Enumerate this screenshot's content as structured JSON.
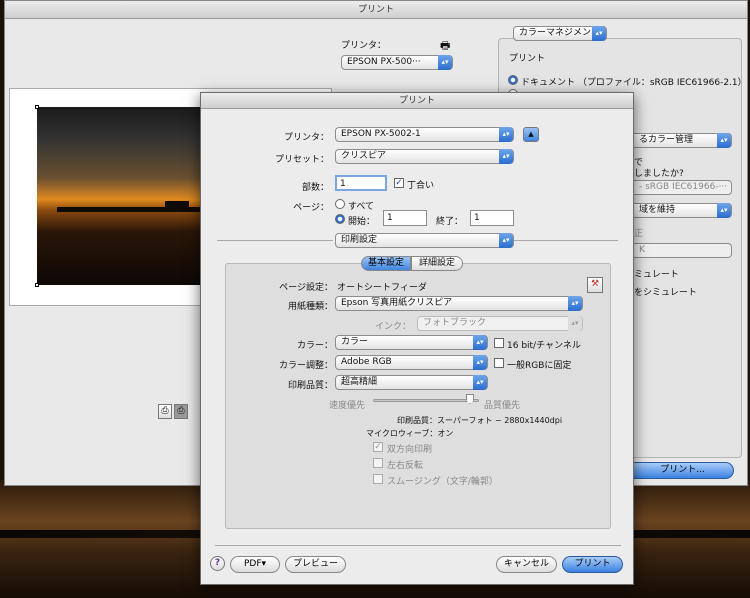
{
  "back_window": {
    "title": "プリント",
    "printer_label": "プリンタ：",
    "printer_value": "EPSON PX-500···",
    "color_mgmt_popup": "カラーマネジメント",
    "print_heading": "プリント",
    "document_radio": "ドキュメント （プロファイル：sRGB IEC61966-2.1）",
    "partial_1": "るカラー管理",
    "partial_2": "で",
    "partial_3": "しましたか?",
    "partial_4": "- sRGB IEC61966-···",
    "partial_5": "域を維持",
    "partial_6": "正",
    "partial_7": "K",
    "partial_8": "ミュレート",
    "partial_9": "をシミュレート",
    "print_button": "プリント..."
  },
  "dialog": {
    "title": "プリント",
    "printer_label": "プリンタ：",
    "printer_value": "EPSON PX-5002-1",
    "preset_label": "プリセット：",
    "preset_value": "クリスピア",
    "copies_label": "部数：",
    "copies_value": "1",
    "collate_label": "丁合い",
    "pages_label": "ページ：",
    "all_label": "すべて",
    "from_label": "開始：",
    "from_value": "1",
    "to_label": "終了：",
    "to_value": "1",
    "section_popup": "印刷設定",
    "tab_basic": "基本設定",
    "tab_advanced": "詳細設定",
    "page_setup_label": "ページ設定：",
    "page_setup_value": "オートシートフィーダ",
    "paper_type_label": "用紙種類：",
    "paper_type_value": "Epson 写真用紙クリスピア",
    "ink_label": "インク：",
    "ink_value": "フォトブラック",
    "color_label": "カラー：",
    "color_value": "カラー",
    "bit16_label": "16 bit/チャンネル",
    "color_adjust_label": "カラー調整：",
    "color_adjust_value": "Adobe RGB",
    "fixed_rgb_label": "一般RGBに固定",
    "quality_label": "印刷品質：",
    "quality_value": "超高精細",
    "speed_label": "速度優先",
    "quality_pri_label": "品質優先",
    "info_quality": "印刷品質：スーパーフォト − 2880x1440dpi",
    "info_microweave": "マイクロウィーブ：オン",
    "opt_bidirectional": "双方向印刷",
    "opt_mirror": "左右反転",
    "opt_smoothing": "スムージング（文字/輪郭）",
    "help": "?",
    "pdf_button": "PDF▾",
    "preview_button": "プレビュー",
    "cancel_button": "キャンセル",
    "print_button": "プリント"
  },
  "icons": {
    "up_arrow": "▲",
    "popup_arrows": "▴▾",
    "check": "✓",
    "printer_icon": "🖶"
  },
  "colors": {
    "accent": "#3b82e2"
  }
}
